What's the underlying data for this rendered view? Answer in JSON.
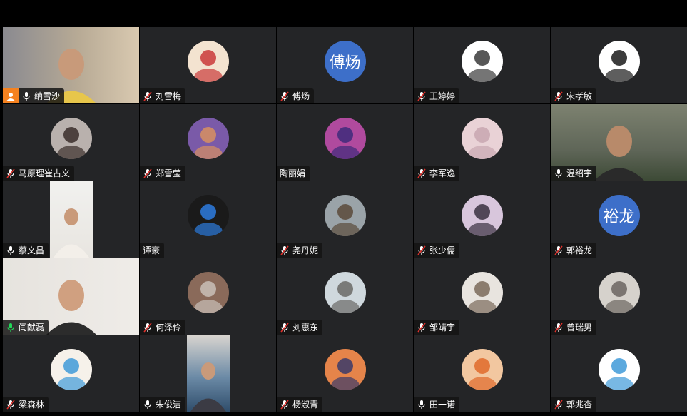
{
  "participants": [
    {
      "name": "纳雪沙",
      "mic": "on",
      "host": true,
      "display": "video"
    },
    {
      "name": "刘雪梅",
      "mic": "muted",
      "display": "avatar-pic",
      "icon": "girl-cartoon-icon",
      "colors": [
        "#f3e3d0",
        "#c93a3a"
      ]
    },
    {
      "name": "傅炀",
      "mic": "muted",
      "display": "avatar-text",
      "avatar_text": "傅炀",
      "color": "#3d6fc9"
    },
    {
      "name": "王婷婷",
      "mic": "muted",
      "display": "avatar-pic",
      "icon": "anime-girl-icon",
      "colors": [
        "#ffffff",
        "#3a3a3a"
      ]
    },
    {
      "name": "宋孝敏",
      "mic": "muted",
      "display": "avatar-pic",
      "icon": "masked-boy-icon",
      "colors": [
        "#ffffff",
        "#1a1a1a"
      ]
    },
    {
      "name": "马原理崔占义",
      "mic": "muted",
      "display": "avatar-pic",
      "icon": "woman-photo-icon",
      "colors": [
        "#b9b1ad",
        "#3a2e2a"
      ]
    },
    {
      "name": "郑雪莹",
      "mic": "muted",
      "display": "avatar-pic",
      "icon": "deer-icon",
      "colors": [
        "#7a5aa8",
        "#d89060"
      ]
    },
    {
      "name": "陶丽娟",
      "mic": "none",
      "display": "avatar-pic",
      "icon": "galaxy-icon",
      "colors": [
        "#b04a9e",
        "#3e2a7a"
      ]
    },
    {
      "name": "李军逸",
      "mic": "muted",
      "display": "avatar-pic",
      "icon": "pink-sky-icon",
      "colors": [
        "#e9d2d6",
        "#c8a7b0"
      ]
    },
    {
      "name": "温绍宇",
      "mic": "on",
      "display": "video"
    },
    {
      "name": "蔡文昌",
      "mic": "on",
      "display": "video-portrait"
    },
    {
      "name": "谭豪",
      "mic": "none",
      "display": "avatar-pic",
      "icon": "megaman-icon",
      "colors": [
        "#1a1a1a",
        "#2e7de0"
      ]
    },
    {
      "name": "尧丹妮",
      "mic": "muted",
      "display": "avatar-pic",
      "icon": "crowd-photo-icon",
      "colors": [
        "#9aa3a8",
        "#5a4a3a"
      ]
    },
    {
      "name": "张少儒",
      "mic": "muted",
      "display": "avatar-pic",
      "icon": "tree-icon",
      "colors": [
        "#d8c6dc",
        "#3a3040"
      ]
    },
    {
      "name": "郭裕龙",
      "mic": "muted",
      "display": "avatar-text",
      "avatar_text": "裕龙",
      "color": "#3d6fc9"
    },
    {
      "name": "闫献磊",
      "mic": "active",
      "display": "video",
      "speaking": true
    },
    {
      "name": "何泽伶",
      "mic": "muted",
      "display": "avatar-pic",
      "icon": "room-photo-icon",
      "colors": [
        "#8a6a5a",
        "#c9c0b8"
      ]
    },
    {
      "name": "刘惠东",
      "mic": "muted",
      "display": "avatar-pic",
      "icon": "beach-icon",
      "colors": [
        "#cfd8dd",
        "#6a6a66"
      ]
    },
    {
      "name": "邹靖宇",
      "mic": "muted",
      "display": "avatar-pic",
      "icon": "person-door-icon",
      "colors": [
        "#e8e4df",
        "#7a6a5a"
      ]
    },
    {
      "name": "曾瑞男",
      "mic": "muted",
      "display": "avatar-pic",
      "icon": "cat-icon",
      "colors": [
        "#d6d2cc",
        "#6b6560"
      ]
    },
    {
      "name": "梁森林",
      "mic": "muted",
      "display": "avatar-pic",
      "icon": "doraemon-icon",
      "colors": [
        "#f6f1ea",
        "#3f9ad8"
      ]
    },
    {
      "name": "朱俊洁",
      "mic": "on",
      "display": "video-portrait"
    },
    {
      "name": "杨淑青",
      "mic": "muted",
      "display": "avatar-pic",
      "icon": "sunset-icon",
      "colors": [
        "#e5844a",
        "#3a3a6a"
      ]
    },
    {
      "name": "田一诺",
      "mic": "on",
      "display": "avatar-pic",
      "icon": "tiger-girl-icon",
      "colors": [
        "#f2c7a0",
        "#e06a2a"
      ]
    },
    {
      "name": "郭兆杏",
      "mic": "muted",
      "display": "avatar-pic",
      "icon": "doraemon-face-icon",
      "colors": [
        "#ffffff",
        "#3f9ad8"
      ]
    }
  ]
}
